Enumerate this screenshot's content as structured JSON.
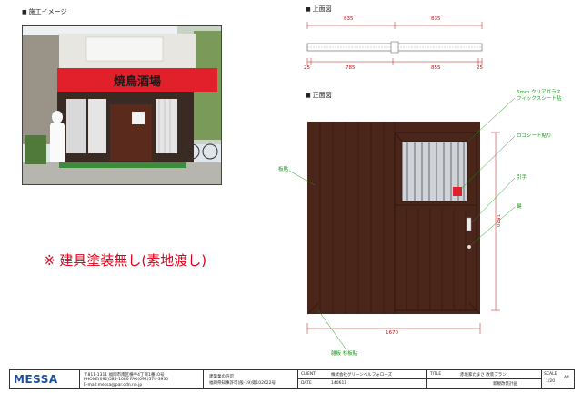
{
  "sections": {
    "construction_image": "施工イメージ",
    "plan_view": "上面図",
    "front_view": "正面図"
  },
  "photo": {
    "sign_text": "焼鳥酒場",
    "sign_color": "#e2202c"
  },
  "note": "※ 建具塗装無し(素地渡し)",
  "dimensions": {
    "plan_top_left": "835",
    "plan_top_right": "835",
    "plan_bottom": [
      "25",
      "785",
      "855",
      "25"
    ],
    "front_width": "1670",
    "front_height": "1870"
  },
  "annotations": {
    "glass": "5mm クリアガラス\nフィックスシート貼",
    "corner_mark": "ロゴシート貼り",
    "handle": "引手",
    "key": "鍵",
    "board": "板貼",
    "bottom": "雑板 杉板貼"
  },
  "colors": {
    "wood": "#4a2519",
    "wood_line": "#2e140c",
    "leader": "#1a9a1a",
    "dim": "#c21010"
  },
  "titleblock": {
    "logo": "MESSA",
    "company_lines": [
      "〒811-1311 福岡市南区横手4丁目1番10号",
      "PHONE(092)585-1080 FAX(092)574-3930",
      "E-mail:messa@par.odn.ne.jp"
    ],
    "license_lines": [
      "建築業の許可",
      "福岡県知事許可(般-19)第102622号"
    ],
    "client_label": "CLIENT",
    "client": "株式会社グリーンベルフォローズ",
    "title_label": "TITLE",
    "title": "赤坂家たまさ 改装プラン",
    "date_label": "DATE",
    "date": "140611",
    "subtitle": "新規改装計画",
    "scale_label": "SCALE",
    "scale": "1/20",
    "sheet": "A4"
  }
}
